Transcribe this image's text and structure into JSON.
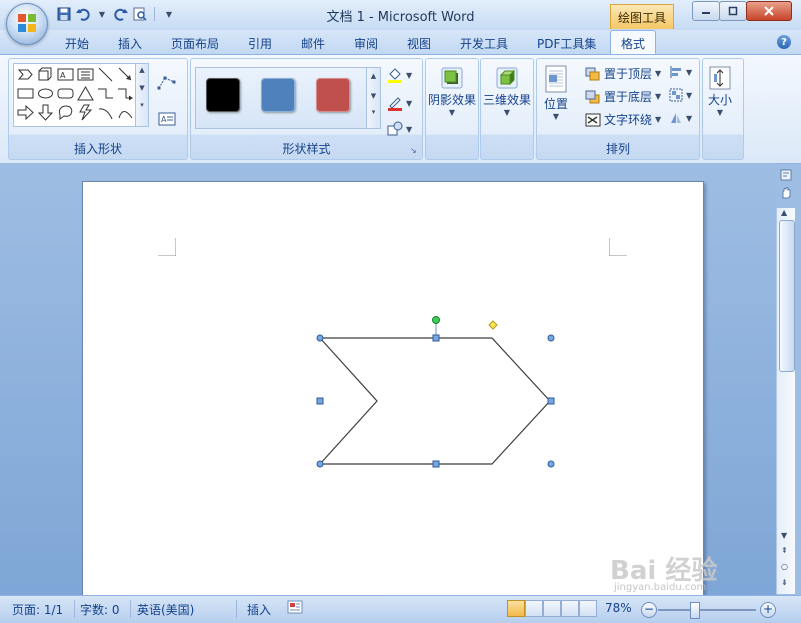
{
  "window": {
    "title": "文档 1 - Microsoft Word",
    "context_tab_title": "绘图工具",
    "minimize_icon": "minimize-icon",
    "maximize_icon": "maximize-icon",
    "close_icon": "close-icon"
  },
  "quick_access": {
    "items": [
      "save-icon",
      "undo-icon",
      "redo-icon",
      "print-preview-icon",
      "customize-qat-icon"
    ]
  },
  "tabs": [
    {
      "label": "开始"
    },
    {
      "label": "插入"
    },
    {
      "label": "页面布局"
    },
    {
      "label": "引用"
    },
    {
      "label": "邮件"
    },
    {
      "label": "审阅"
    },
    {
      "label": "视图"
    },
    {
      "label": "开发工具"
    },
    {
      "label": "PDF工具集"
    },
    {
      "label": "格式",
      "active": true
    }
  ],
  "ribbon": {
    "insert_shapes": {
      "label": "插入形状"
    },
    "shape_styles": {
      "label": "形状样式",
      "swatches": [
        {
          "color": "#000000"
        },
        {
          "color": "#4f81bd"
        },
        {
          "color": "#c0504d"
        }
      ]
    },
    "shadow": {
      "label": "阴影效果"
    },
    "three_d": {
      "label": "三维效果"
    },
    "arrange": {
      "label": "排列",
      "position_label": "位置",
      "bring_to_front": "置于顶层",
      "send_to_back": "置于底层",
      "text_wrap": "文字环绕"
    },
    "size": {
      "label": "大小"
    }
  },
  "status": {
    "page": "页面: 1/1",
    "words": "字数: 0",
    "language": "英语(美国)",
    "mode": "插入",
    "zoom": "78%"
  },
  "watermark": {
    "text": "Bai 经验",
    "sub": "jingyan.baidu.com"
  }
}
